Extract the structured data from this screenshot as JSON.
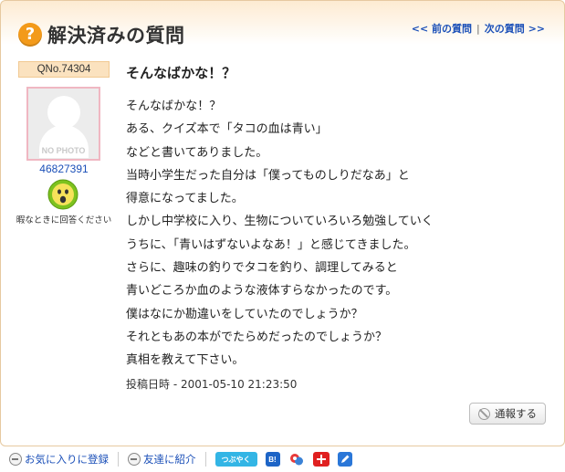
{
  "header": {
    "title": "解決済みの質問",
    "prev_label": "<< 前の質問",
    "separator": "|",
    "next_label": "次の質問 >>"
  },
  "user": {
    "question_no": "QNo.74304",
    "avatar_text": "NO PHOTO",
    "id": "46827391",
    "status": "暇なときに回答ください"
  },
  "question": {
    "title": "そんなばかな！？",
    "lines": [
      "そんなばかな！？",
      "ある、クイズ本で「タコの血は青い」",
      "などと書いてありました。",
      "当時小学生だった自分は「僕ってものしりだなあ」と",
      "得意になってました。",
      "しかし中学校に入り、生物についていろいろ勉強していく",
      "うちに、「青いはずないよなあ！」と感じてきました。",
      "さらに、趣味の釣りでタコを釣り、調理してみると",
      "青いどころか血のような液体すらなかったのです。",
      "僕はなにか勘違いをしていたのでしょうか？",
      "それともあの本がでたらめだったのでしょうか？",
      "真相を教えて下さい。"
    ],
    "posted": "投稿日時 - 2001-05-10 21:23:50"
  },
  "report_label": "通報する",
  "footer": {
    "favorite_label": "お気に入りに登録",
    "share_label": "友達に紹介",
    "twitter_label": "つぶやく",
    "hatena_label": "B!"
  },
  "colors": {
    "accent_orange": "#f39a1a",
    "link_blue": "#1a4fb8",
    "face_green": "#7dc21e"
  }
}
